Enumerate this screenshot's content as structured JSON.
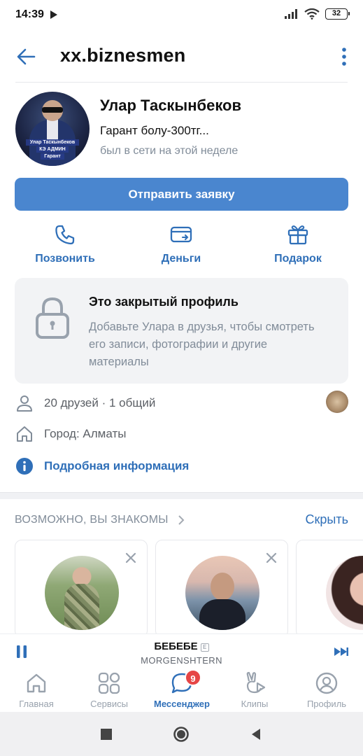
{
  "status_bar": {
    "time": "14:39",
    "battery": "32"
  },
  "header": {
    "title": "xx.biznesmen"
  },
  "profile": {
    "avatar_text_1": "Улар Таскынбеков",
    "avatar_text_2": "КЭ АДМИН",
    "avatar_text_3": "Гарант",
    "name": "Улар Таскынбеков",
    "status": "Гарант болу-300тг...",
    "online": "был в сети на этой неделе",
    "send_request": "Отправить заявку"
  },
  "actions": [
    {
      "label": "Позвонить",
      "icon": "phone-icon"
    },
    {
      "label": "Деньги",
      "icon": "money-card-icon"
    },
    {
      "label": "Подарок",
      "icon": "gift-icon"
    }
  ],
  "closed_profile": {
    "title": "Это закрытый профиль",
    "text": "Добавьте Улара в друзья, чтобы смотреть его записи, фотографии и другие материалы"
  },
  "info": {
    "friends": "20 друзей · 1 общий",
    "city": "Город: Алматы",
    "details": "Подробная информация"
  },
  "suggestions": {
    "title": "ВОЗМОЖНО, ВЫ ЗНАКОМЫ",
    "hide": "Скрыть"
  },
  "player": {
    "title": "БЕБЕБЕ",
    "explicit": "E",
    "artist": "MORGENSHTERN"
  },
  "tabs": [
    {
      "label": "Главная",
      "icon": "home-icon"
    },
    {
      "label": "Сервисы",
      "icon": "services-icon"
    },
    {
      "label": "Мессенджер",
      "icon": "messenger-icon",
      "badge": "9",
      "active": true
    },
    {
      "label": "Клипы",
      "icon": "clips-icon"
    },
    {
      "label": "Профиль",
      "icon": "profile-icon"
    }
  ],
  "colors": {
    "accent": "#4a86cf",
    "link": "#2f6fb8",
    "badge": "#e64646",
    "muted": "#818c99"
  }
}
